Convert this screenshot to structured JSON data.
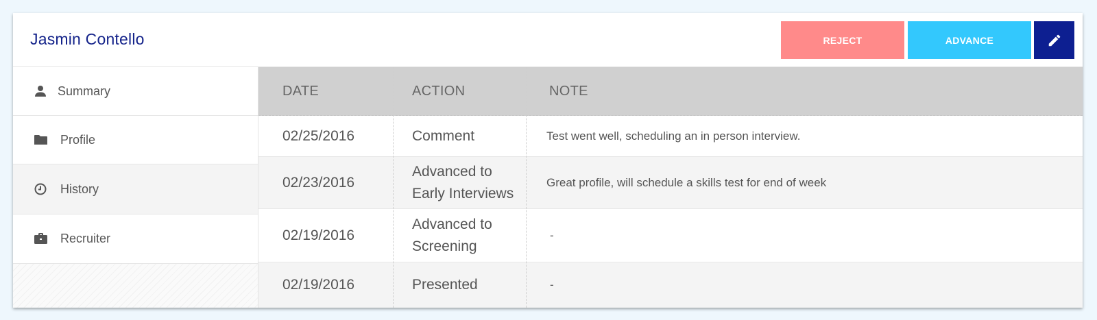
{
  "header": {
    "candidate_name": "Jasmin Contello",
    "reject_label": "REJECT",
    "advance_label": "ADVANCE",
    "edit_icon": "pencil-icon"
  },
  "colors": {
    "reject": "#ff8a8a",
    "advance": "#33c8fd",
    "edit": "#0d1f91",
    "name": "#14238a"
  },
  "sidebar": {
    "items": [
      {
        "label": "Summary",
        "icon": "person-icon"
      },
      {
        "label": "Profile",
        "icon": "folder-icon"
      },
      {
        "label": "History",
        "icon": "clock-icon",
        "active": true
      },
      {
        "label": "Recruiter",
        "icon": "briefcase-icon"
      }
    ]
  },
  "history_table": {
    "columns": [
      "DATE",
      "ACTION",
      "NOTE"
    ],
    "rows": [
      {
        "date": "02/25/2016",
        "action": "Comment",
        "note": "Test went well, scheduling an in person interview."
      },
      {
        "date": "02/23/2016",
        "action": "Advanced to Early Interviews",
        "note": "Great profile, will schedule a skills test for end of week"
      },
      {
        "date": "02/19/2016",
        "action": "Advanced to Screening",
        "note": "-"
      },
      {
        "date": "02/19/2016",
        "action": "Presented",
        "note": "-"
      }
    ]
  }
}
